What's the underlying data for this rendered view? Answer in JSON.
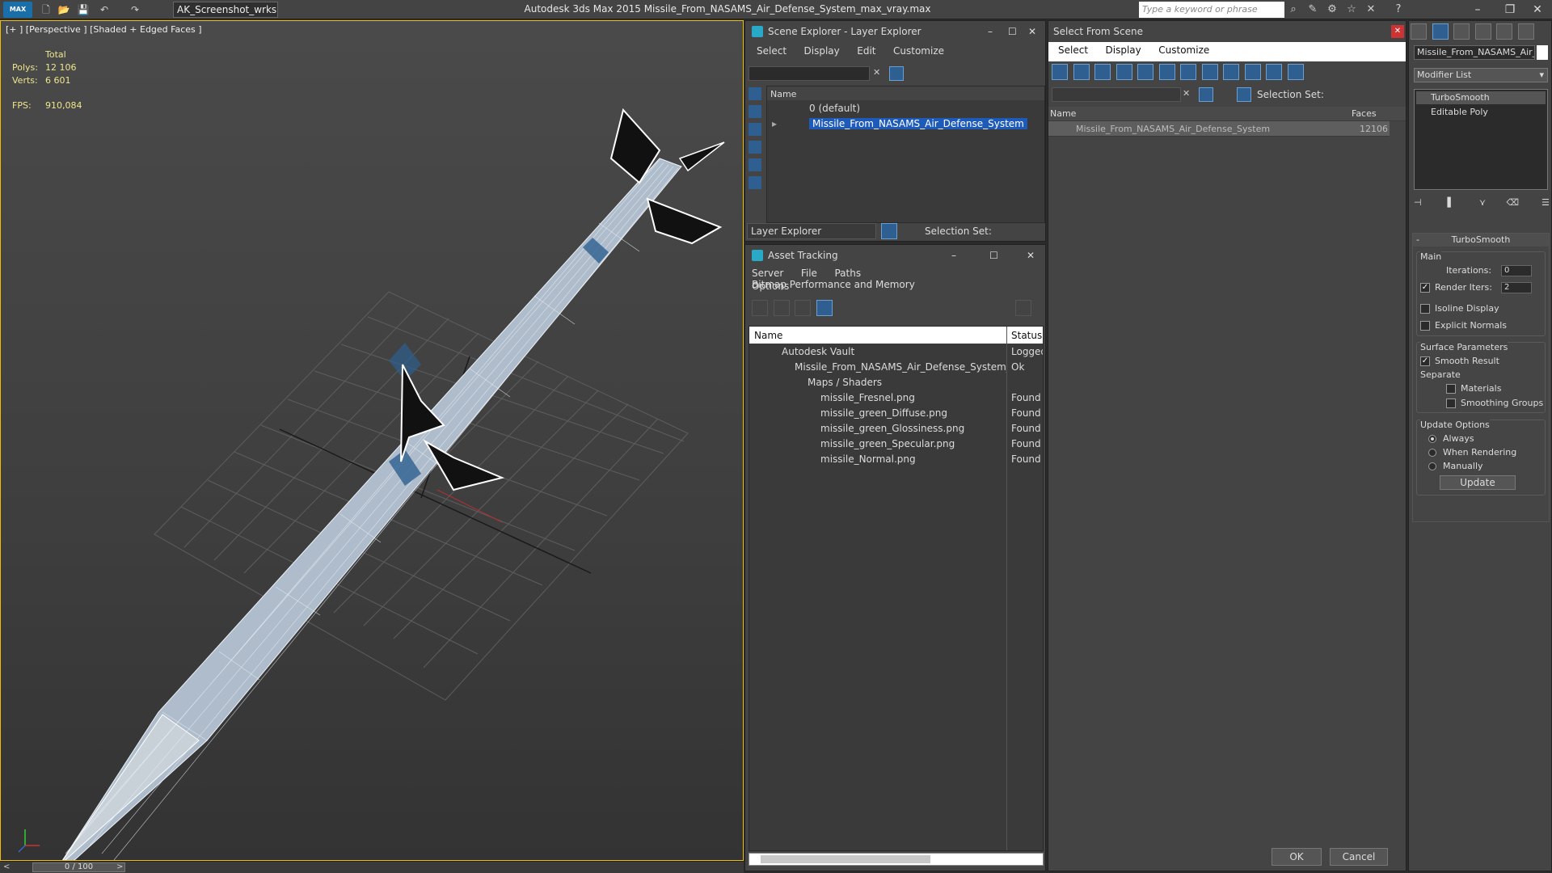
{
  "titlebar": {
    "logo_label": "MAX",
    "workspace": "AK_Screenshot_wrksp",
    "app_title": "Autodesk 3ds Max  2015     Missile_From_NASAMS_Air_Defense_System_max_vray.max",
    "search_placeholder": "Type a keyword or phrase"
  },
  "viewport": {
    "label": "[+ ] [Perspective ] [Shaded + Edged Faces ]",
    "stats": {
      "total_label": "Total",
      "polys_label": "Polys:",
      "polys_value": "12 106",
      "verts_label": "Verts:",
      "verts_value": "6 601",
      "fps_label": "FPS:",
      "fps_value": "910,084"
    }
  },
  "timeline": {
    "label": "0 / 100",
    "prev": "<",
    "next": ">"
  },
  "scene_explorer": {
    "title": "Scene Explorer - Layer Explorer",
    "menu": [
      "Select",
      "Display",
      "Edit",
      "Customize"
    ],
    "column_name": "Name",
    "rows": [
      "0 (default)",
      "Missile_From_NASAMS_Air_Defense_System"
    ],
    "footer_dropdown": "Layer Explorer",
    "selection_set_label": "Selection Set:"
  },
  "asset_tracking": {
    "title": "Asset Tracking",
    "menu": [
      "Server",
      "File",
      "Paths",
      "Bitmap Performance and Memory"
    ],
    "menu2": "Options",
    "col_name": "Name",
    "col_status": "Status",
    "rows": [
      {
        "name": "Autodesk Vault",
        "status": "Logged"
      },
      {
        "name": "Missile_From_NASAMS_Air_Defense_System_m...",
        "status": "Ok"
      },
      {
        "name": "Maps / Shaders",
        "status": ""
      },
      {
        "name": "missile_Fresnel.png",
        "status": "Found"
      },
      {
        "name": "missile_green_Diffuse.png",
        "status": "Found"
      },
      {
        "name": "missile_green_Glossiness.png",
        "status": "Found"
      },
      {
        "name": "missile_green_Specular.png",
        "status": "Found"
      },
      {
        "name": "missile_Normal.png",
        "status": "Found"
      }
    ]
  },
  "select_from_scene": {
    "title": "Select From Scene",
    "menu": [
      "Select",
      "Display",
      "Customize"
    ],
    "selection_set_label": "Selection Set:",
    "col_name": "Name",
    "col_faces": "Faces",
    "rows": [
      {
        "name": "Missile_From_NASAMS_Air_Defense_System",
        "faces": "12106"
      }
    ],
    "ok": "OK",
    "cancel": "Cancel"
  },
  "command_panel": {
    "object_name": "Missile_From_NASAMS_Air_D",
    "modifier_list": "Modifier List",
    "stack": [
      "TurboSmooth",
      "Editable Poly"
    ],
    "rollout_title": "TurboSmooth",
    "main_label": "Main",
    "iterations_label": "Iterations:",
    "iterations_value": "0",
    "render_iters_label": "Render Iters:",
    "render_iters_value": "2",
    "isoline_label": "Isoline Display",
    "explicit_normals_label": "Explicit Normals",
    "surface_label": "Surface Parameters",
    "smooth_result_label": "Smooth Result",
    "separate_label": "Separate",
    "materials_label": "Materials",
    "smoothing_groups_label": "Smoothing Groups",
    "update_options_label": "Update Options",
    "always_label": "Always",
    "when_rendering_label": "When Rendering",
    "manually_label": "Manually",
    "update_button": "Update"
  }
}
